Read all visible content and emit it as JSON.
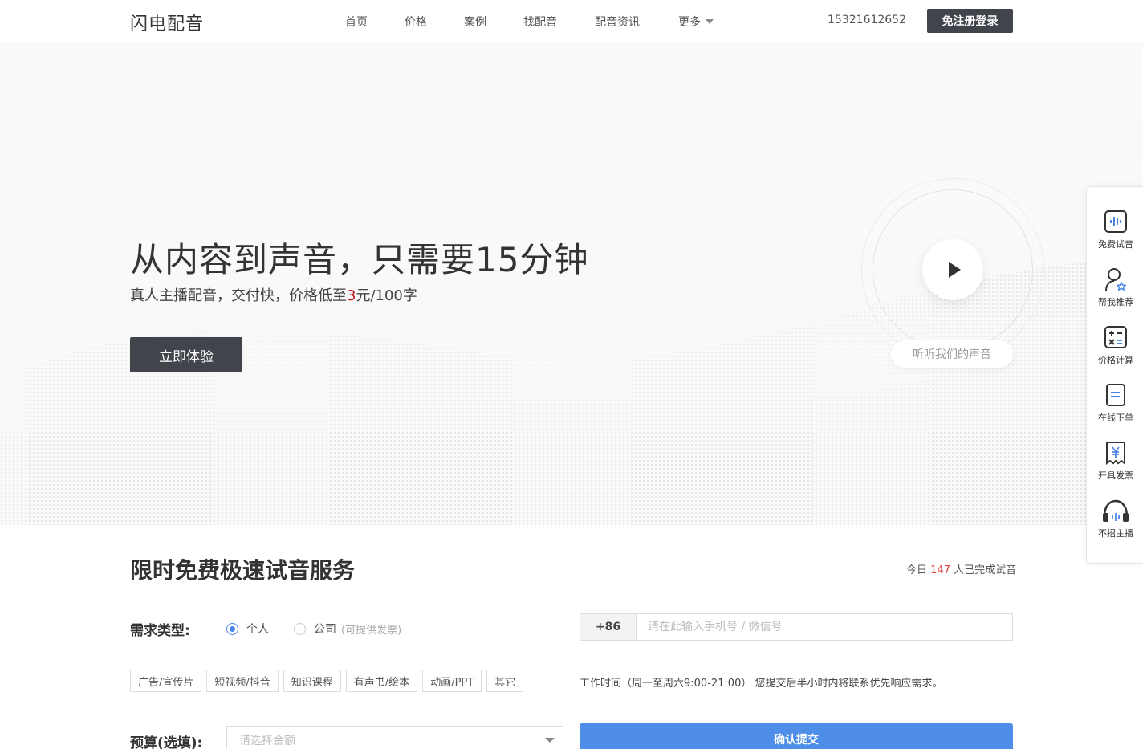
{
  "header": {
    "logo": "闪电配音",
    "nav": [
      "首页",
      "价格",
      "案例",
      "找配音",
      "配音资讯"
    ],
    "more": "更多",
    "phone": "15321612652",
    "login": "免注册登录"
  },
  "hero": {
    "title": "从内容到声音，只需要15分钟",
    "sub_before": "真人主播配音，交付快，价格低至",
    "sub_price": "3",
    "sub_after": "元/100字",
    "try_btn": "立即体验",
    "listen": "听听我们的声音",
    "play_icon": "play-icon"
  },
  "section": {
    "title": "限时免费极速试音服务",
    "today_prefix": "今日",
    "today_count": "147",
    "today_suffix": "人已完成试音",
    "type_label": "需求类型:",
    "radio_personal": "个人",
    "radio_company": "公司",
    "radio_company_note": "(可提供发票)",
    "tags": [
      "广告/宣传片",
      "短视频/抖音",
      "知识课程",
      "有声书/绘本",
      "动画/PPT",
      "其它"
    ],
    "country_code": "+86",
    "contact_placeholder": "请在此输入手机号 / 微信号",
    "work_time": "工作时间（周一至周六9:00-21:00） 您提交后半小时内将联系优先响应需求。",
    "budget_label": "预算(选填):",
    "budget_placeholder": "请选择金额",
    "submit": "确认提交"
  },
  "sidebar": [
    {
      "label": "免费试音",
      "icon": "audio-wave-icon"
    },
    {
      "label": "帮我推荐",
      "icon": "user-star-icon"
    },
    {
      "label": "价格计算",
      "icon": "calculator-icon"
    },
    {
      "label": "在线下单",
      "icon": "order-icon"
    },
    {
      "label": "开具发票",
      "icon": "invoice-icon"
    },
    {
      "label": "不招主播",
      "icon": "headphones-icon"
    }
  ],
  "colors": {
    "dark_button": "#41444b",
    "accent_blue": "#4f8ee8",
    "price_red": "#c0141e",
    "count_red": "#e04040"
  }
}
